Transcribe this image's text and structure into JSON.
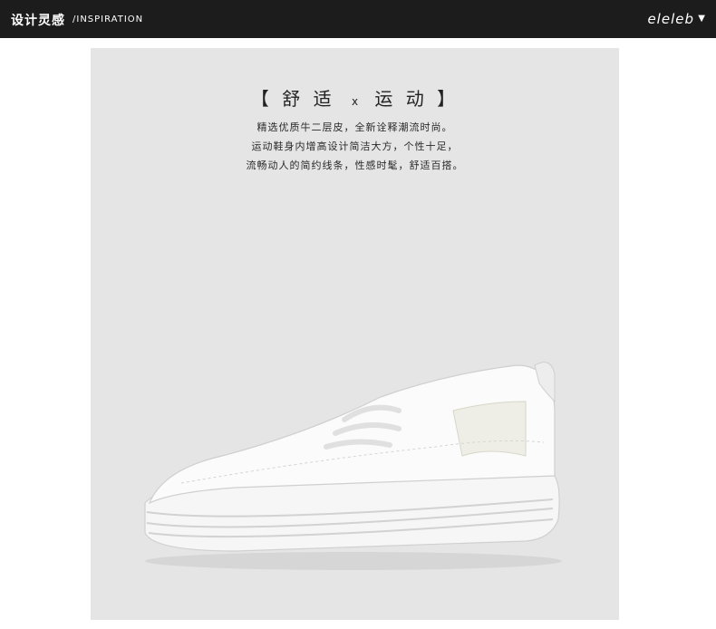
{
  "header": {
    "title_cn": "设计灵感",
    "title_en": "/INSPIRATION",
    "brand": "eleleb",
    "dropdown_icon": "chevron-down-icon"
  },
  "panel": {
    "headline_left": "【 舒 适",
    "headline_x": "x",
    "headline_right": "运 动 】",
    "description_lines": [
      "精选优质牛二层皮，全新诠释潮流时尚。",
      "运动鞋身内增高设计简洁大方，个性十足，",
      "流畅动人的简约线条，性感时髦，舒适百搭。"
    ],
    "colors": {
      "background": "#e5e5e5",
      "topbar": "#1c1c1c"
    }
  }
}
